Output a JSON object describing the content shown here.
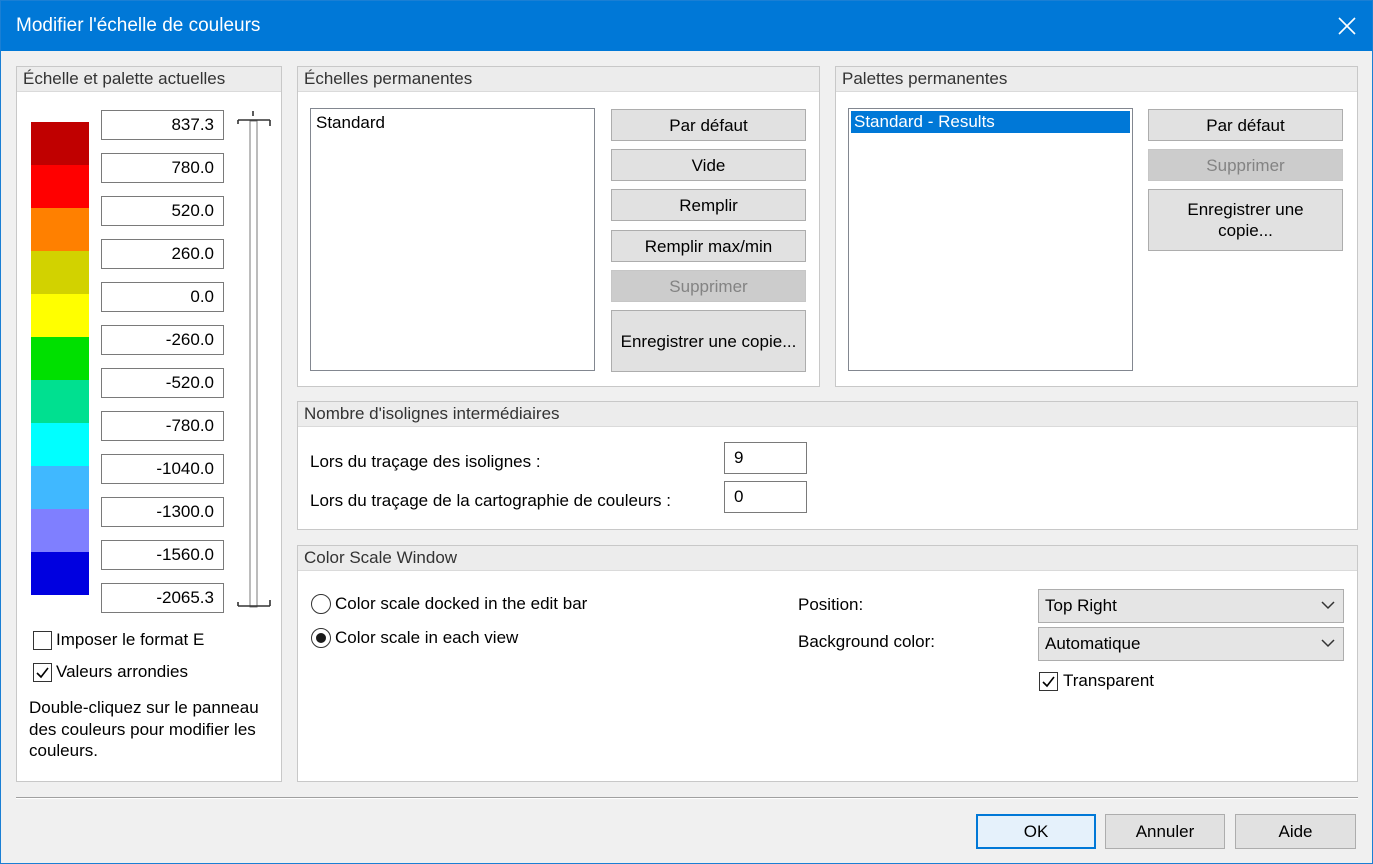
{
  "window": {
    "title": "Modifier l'échelle de couleurs",
    "close_icon": "close-icon"
  },
  "current": {
    "header": "Échelle et palette actuelles",
    "values": [
      "837.3",
      "780.0",
      "520.0",
      "260.0",
      "0.0",
      "-260.0",
      "-520.0",
      "-780.0",
      "-1040.0",
      "-1300.0",
      "-1560.0",
      "-2065.3"
    ],
    "colors": [
      "#c00000",
      "#ff0000",
      "#ff8000",
      "#d2d200",
      "#ffff00",
      "#00e000",
      "#00e090",
      "#00ffff",
      "#40b8ff",
      "#7f7fff",
      "#0000e0"
    ],
    "impose_format_e": {
      "label": "Imposer le format E",
      "checked": false
    },
    "rounded_values": {
      "label": "Valeurs arrondies",
      "checked": true
    },
    "hint": "Double-cliquez sur le panneau des couleurs pour modifier les couleurs."
  },
  "scales": {
    "header": "Échelles permanentes",
    "items": [
      "Standard"
    ],
    "buttons": {
      "default": "Par défaut",
      "empty": "Vide",
      "fill": "Remplir",
      "fill_maxmin": "Remplir max/min",
      "delete": "Supprimer",
      "save_copy": "Enregistrer une copie..."
    }
  },
  "palettes": {
    "header": "Palettes permanentes",
    "items": [
      "Standard - Results"
    ],
    "selected_index": 0,
    "buttons": {
      "default": "Par défaut",
      "delete": "Supprimer",
      "save_copy": "Enregistrer une copie..."
    }
  },
  "isolines": {
    "header": "Nombre d'isolignes intermédiaires",
    "isolines_label": "Lors du traçage des isolignes :",
    "isolines_value": "9",
    "colormap_label": "Lors du traçage de la cartographie de couleurs :",
    "colormap_value": "0"
  },
  "scale_window": {
    "header": "Color Scale Window",
    "radio_docked": {
      "label": "Color scale docked in the edit bar",
      "checked": false
    },
    "radio_each_view": {
      "label": "Color scale in each view",
      "checked": true
    },
    "position_label": "Position:",
    "position_value": "Top Right",
    "background_label": "Background color:",
    "background_value": "Automatique",
    "transparent": {
      "label": "Transparent",
      "checked": true
    }
  },
  "footer": {
    "ok": "OK",
    "cancel": "Annuler",
    "help": "Aide"
  }
}
